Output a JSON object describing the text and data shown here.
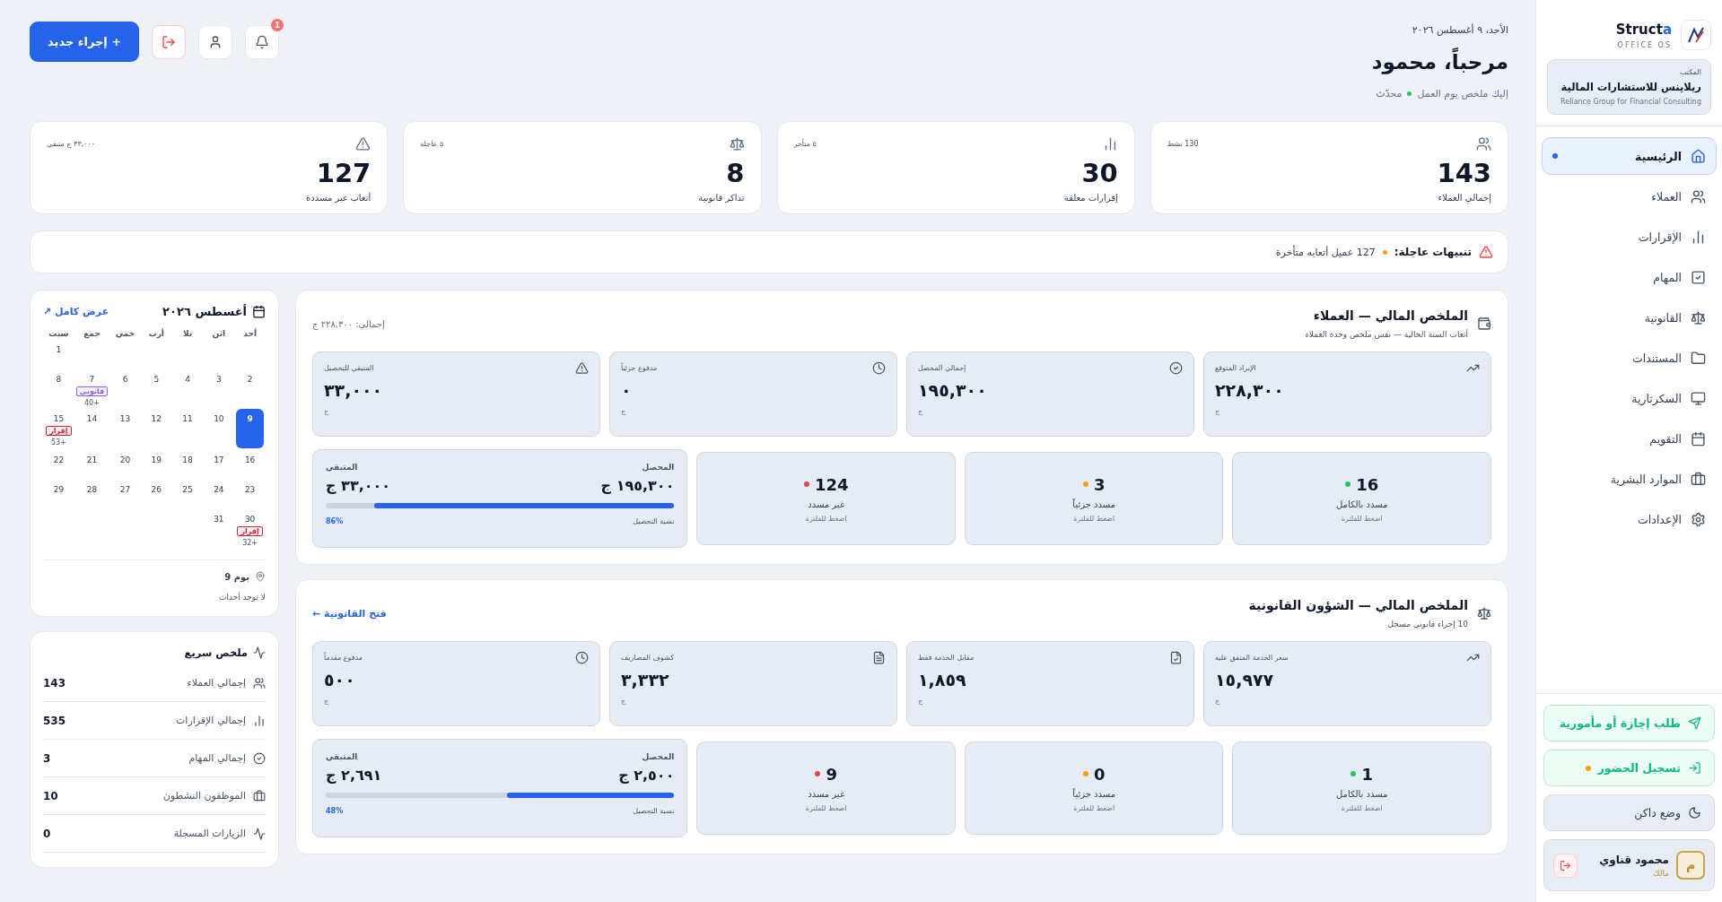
{
  "sidebar": {
    "brand": {
      "main": "Struct",
      "accent": "a"
    },
    "tagline": "OFFICE OS",
    "office": {
      "label": "المكتب",
      "name": "ريلاينس للاستشارات المالية",
      "name_en": "Reliance Group for Financial Consulting"
    },
    "items": [
      {
        "label": "الرئيسية",
        "selected": true
      },
      {
        "label": "العملاء",
        "selected": false
      },
      {
        "label": "الإقرارات",
        "selected": false
      },
      {
        "label": "المهام",
        "selected": false
      },
      {
        "label": "القانونية",
        "selected": false
      },
      {
        "label": "المستندات",
        "selected": false
      },
      {
        "label": "السكرتارية",
        "selected": false
      },
      {
        "label": "التقويم",
        "selected": false
      },
      {
        "label": "الموارد البشرية",
        "selected": false
      },
      {
        "label": "الإعدادات",
        "selected": false
      }
    ],
    "leave_button": "طلب إجازة أو مأمورية",
    "attendance_button": "تسجيل الحضور",
    "dark_mode": "وضع داكن",
    "user": {
      "name": "محمود قناوي",
      "role": "مالك",
      "initial": "م"
    }
  },
  "header": {
    "date": "الأحد، ٩ أغسطس ٢٠٢٦",
    "title": "مرحباً، محمود",
    "subtitle": "إليك ملخص يوم العمل",
    "status": "محدّث",
    "notifications": "1",
    "new_button": "+ إجراء جديد"
  },
  "stats": [
    {
      "label": "إجمالي العملاء",
      "value": "143",
      "note": "130 نشط"
    },
    {
      "label": "إقرارات معلقة",
      "value": "30",
      "note": "٥ متأخر"
    },
    {
      "label": "تذاكر قانونية",
      "value": "8",
      "note": "٥ عاجلة"
    },
    {
      "label": "أتعاب غير مسددة",
      "value": "127",
      "note": "٣٣,٠٠٠ ج متبقي"
    }
  ],
  "alert": {
    "title": "تنبيهات عاجلة:",
    "text": "127 عميل أتعابه متأخرة"
  },
  "sections": [
    {
      "title": "الملخص المالي — العملاء",
      "subtitle": "أتعاب السنة الحالية — نفس ملخص وحدة العملاء",
      "side": "إجمالي: ٢٢٨,٣٠٠ ج",
      "kind": "total",
      "metrics": [
        {
          "label": "الإيراد المتوقع",
          "value": "٢٢٨,٣٠٠",
          "unit": "ج"
        },
        {
          "label": "إجمالي المحصل",
          "value": "١٩٥,٣٠٠",
          "unit": "ج"
        },
        {
          "label": "مدفوع جزئياً",
          "value": "٠",
          "unit": "ج"
        },
        {
          "label": "المتبقي للتحصيل",
          "value": "٣٣,٠٠٠",
          "unit": "ج"
        }
      ],
      "statuses": [
        {
          "value": "16",
          "label": "مسدد بالكامل",
          "hint": "اضغط للفلترة",
          "color": "#22c55e"
        },
        {
          "value": "3",
          "label": "مسدد جزئياً",
          "hint": "اضغط للفلترة",
          "color": "#f59e0b"
        },
        {
          "value": "124",
          "label": "غير مسدد",
          "hint": "اضغط للفلترة",
          "color": "#ef4444"
        }
      ],
      "collection": {
        "collected_label": "المحصل",
        "collected": "١٩٥,٣٠٠ ج",
        "remaining_label": "المتبقي",
        "remaining": "٣٣,٠٠٠ ج",
        "rate_label": "نسبة التحصيل",
        "rate": "86%",
        "level": 0.86
      }
    },
    {
      "title": "الملخص المالي — الشؤون القانونية",
      "subtitle": "10 إجراء قانوني مسجل",
      "side": "فتح القانونية ←",
      "kind": "link",
      "metrics": [
        {
          "label": "سعر الخدمة المتفق عليه",
          "value": "١٥,٩٧٧",
          "unit": "ج"
        },
        {
          "label": "مقابل الخدمة فقط",
          "value": "١,٨٥٩",
          "unit": "ج"
        },
        {
          "label": "كشوف المصاريف",
          "value": "٣,٣٣٢",
          "unit": "ج"
        },
        {
          "label": "مدفوع مقدماً",
          "value": "٥٠٠",
          "unit": "ج"
        }
      ],
      "statuses": [
        {
          "value": "1",
          "label": "مسدد بالكامل",
          "hint": "اضغط للفلترة",
          "color": "#22c55e"
        },
        {
          "value": "0",
          "label": "مسدد جزئياً",
          "hint": "اضغط للفلترة",
          "color": "#f59e0b"
        },
        {
          "value": "9",
          "label": "غير مسدد",
          "hint": "اضغط للفلترة",
          "color": "#ef4444"
        }
      ],
      "collection": {
        "collected_label": "المحصل",
        "collected": "٢,٥٠٠ ج",
        "remaining_label": "المتبقي",
        "remaining": "٢,٦٩١ ج",
        "rate_label": "نسبة التحصيل",
        "rate": "48%",
        "level": 0.48
      }
    }
  ],
  "calendar": {
    "title": "أغسطس ٢٠٢٦",
    "link": "عرض كامل ↗",
    "weekdays": [
      "أحد",
      "اثن",
      "ثلا",
      "أرب",
      "خمي",
      "جمع",
      "سبت"
    ],
    "weeks": [
      [
        {
          "day": "1",
          "selected": false
        }
      ],
      [
        {
          "day": "2",
          "selected": false
        },
        {
          "day": "3",
          "selected": false
        },
        {
          "day": "4",
          "selected": false
        },
        {
          "day": "5",
          "selected": false
        },
        {
          "day": "6",
          "selected": false
        },
        {
          "day": "7",
          "selected": false,
          "tag": "قانوني",
          "more": "40+",
          "color": "#8b5cf6"
        },
        {
          "day": "8",
          "selected": false
        }
      ],
      [
        {
          "day": "9",
          "selected": true
        },
        {
          "day": "10",
          "selected": false
        },
        {
          "day": "11",
          "selected": false
        },
        {
          "day": "12",
          "selected": false
        },
        {
          "day": "13",
          "selected": false
        },
        {
          "day": "14",
          "selected": false
        },
        {
          "day": "15",
          "selected": false,
          "tag": "إقرار",
          "more": "53+",
          "color": "#dc2626"
        }
      ],
      [
        {
          "day": "16",
          "selected": false
        },
        {
          "day": "17",
          "selected": false
        },
        {
          "day": "18",
          "selected": false
        },
        {
          "day": "19",
          "selected": false
        },
        {
          "day": "20",
          "selected": false
        },
        {
          "day": "21",
          "selected": false
        },
        {
          "day": "22",
          "selected": false
        }
      ],
      [
        {
          "day": "23",
          "selected": false
        },
        {
          "day": "24",
          "selected": false
        },
        {
          "day": "25",
          "selected": false
        },
        {
          "day": "26",
          "selected": false
        },
        {
          "day": "27",
          "selected": false
        },
        {
          "day": "28",
          "selected": false
        },
        {
          "day": "29",
          "selected": false
        }
      ],
      [
        {
          "day": "30",
          "selected": false,
          "tag": "إقرار",
          "more": "32+",
          "color": "#dc2626"
        },
        {
          "day": "31",
          "selected": false
        }
      ]
    ],
    "day_title": "يوم 9",
    "empty": "لا توجد أحداث"
  },
  "quick_summary": {
    "title": "ملخص سريع",
    "rows": [
      {
        "label": "إجمالي العملاء",
        "value": "143"
      },
      {
        "label": "إجمالي الإقرارات",
        "value": "535"
      },
      {
        "label": "إجمالي المهام",
        "value": "3"
      },
      {
        "label": "الموظفون النشطون",
        "value": "10"
      },
      {
        "label": "الزيارات المسجلة",
        "value": "0"
      }
    ]
  }
}
